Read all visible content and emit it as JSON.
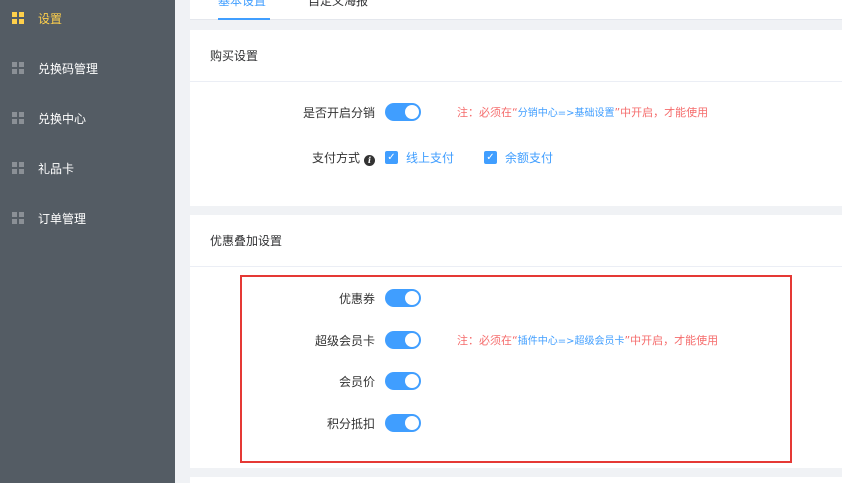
{
  "sidebar": {
    "items": [
      {
        "label": "设置",
        "active": true
      },
      {
        "label": "兑换码管理"
      },
      {
        "label": "兑换中心"
      },
      {
        "label": "礼品卡"
      },
      {
        "label": "订单管理"
      }
    ]
  },
  "tabs": [
    {
      "label": "基本设置",
      "active": true
    },
    {
      "label": "自定义海报"
    }
  ],
  "purchase_card": {
    "title": "购买设置",
    "distribution": {
      "label": "是否开启分销",
      "enabled": true,
      "note_prefix": "注：必须在“",
      "note_path": "分销中心=>基础设置",
      "note_suffix": "”中开启，才能使用"
    },
    "payment": {
      "label": "支付方式",
      "options": [
        {
          "label": "线上支付",
          "checked": true
        },
        {
          "label": "余额支付",
          "checked": true
        }
      ]
    }
  },
  "discount_card": {
    "title": "优惠叠加设置",
    "items": [
      {
        "label": "优惠券",
        "enabled": true
      },
      {
        "label": "超级会员卡",
        "enabled": true,
        "note_prefix": "注：必须在“",
        "note_path": "插件中心=>超级会员卡",
        "note_suffix": "”中开启，才能使用"
      },
      {
        "label": "会员价",
        "enabled": true
      },
      {
        "label": "积分抵扣",
        "enabled": true
      }
    ]
  },
  "colors": {
    "sidebar_bg": "#545c64",
    "active": "#ffd04b",
    "primary": "#409eff",
    "danger": "#f56c6c",
    "highlight": "#e53935"
  }
}
